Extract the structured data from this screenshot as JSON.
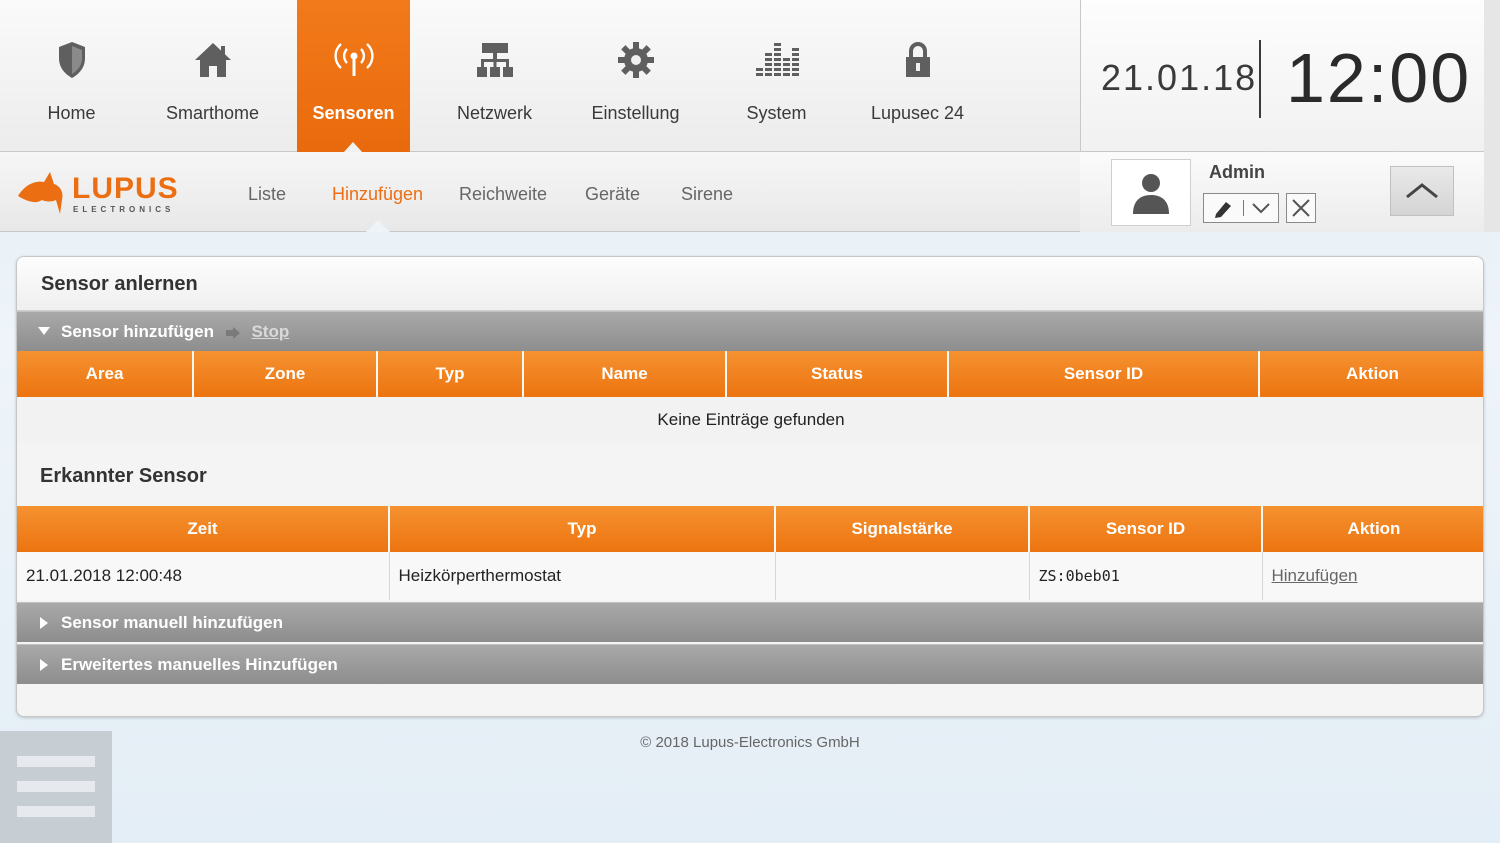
{
  "nav": {
    "items": [
      {
        "label": "Home",
        "icon": "shield-icon"
      },
      {
        "label": "Smarthome",
        "icon": "house-icon"
      },
      {
        "label": "Sensoren",
        "icon": "antenna-icon",
        "active": true
      },
      {
        "label": "Netzwerk",
        "icon": "network-icon"
      },
      {
        "label": "Einstellung",
        "icon": "gear-icon"
      },
      {
        "label": "System",
        "icon": "equalizer-icon"
      },
      {
        "label": "Lupusec 24",
        "icon": "lock-icon"
      }
    ]
  },
  "clock": {
    "date": "21.01.18",
    "time": "12:00"
  },
  "logo": {
    "name": "LUPUS",
    "sub": "ELECTRONICS"
  },
  "subnav": {
    "items": [
      {
        "label": "Liste"
      },
      {
        "label": "Hinzufügen",
        "active": true
      },
      {
        "label": "Reichweite"
      },
      {
        "label": "Geräte"
      },
      {
        "label": "Sirene"
      }
    ]
  },
  "user": {
    "name": "Admin"
  },
  "panel": {
    "title": "Sensor anlernen",
    "add_bar": {
      "label": "Sensor hinzufügen",
      "stop_label": "Stop"
    },
    "sensor_table": {
      "columns": [
        "Area",
        "Zone",
        "Typ",
        "Name",
        "Status",
        "Sensor ID",
        "Aktion"
      ],
      "empty_text": "Keine Einträge gefunden"
    },
    "detected": {
      "title": "Erkannter Sensor",
      "columns": [
        "Zeit",
        "Typ",
        "Signalstärke",
        "Sensor ID",
        "Aktion"
      ],
      "rows": [
        {
          "zeit": "21.01.2018 12:00:48",
          "typ": "Heizkörperthermostat",
          "signal": "",
          "sensor_id": "ZS:0beb01",
          "action": "Hinzufügen"
        }
      ]
    },
    "manual_bar": {
      "label": "Sensor manuell hinzufügen"
    },
    "advanced_bar": {
      "label": "Erweitertes manuelles Hinzufügen"
    }
  },
  "footer": {
    "copyright": "© 2018 Lupus-Electronics GmbH"
  },
  "colors": {
    "accent": "#ec6e12",
    "bar_grey": "#999999"
  }
}
